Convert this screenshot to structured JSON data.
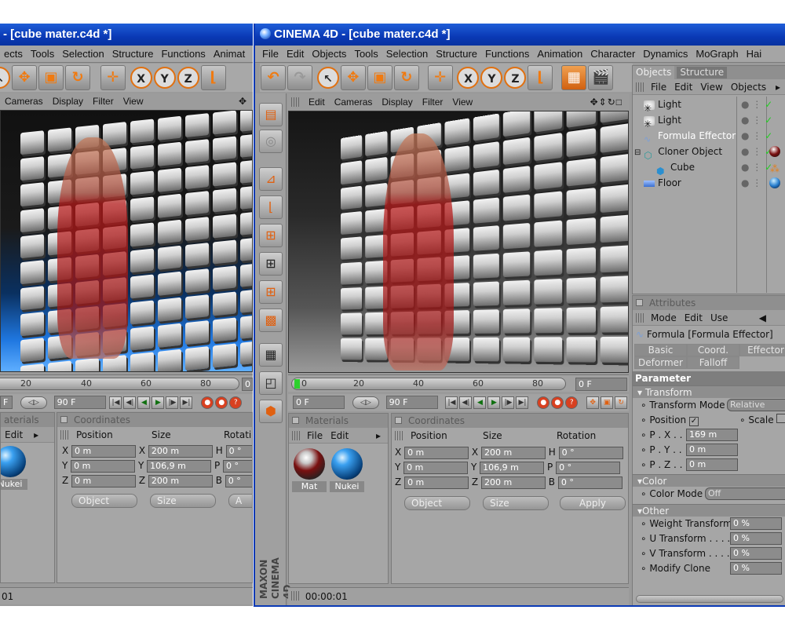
{
  "left_window": {
    "title": "- [cube mater.c4d *]",
    "menu": [
      "ects",
      "Tools",
      "Selection",
      "Structure",
      "Functions",
      "Animat"
    ],
    "viewport_menu": [
      "Cameras",
      "Display",
      "Filter",
      "View"
    ],
    "ruler_ticks": [
      "20",
      "40",
      "60",
      "80"
    ],
    "frame_start": "F",
    "frame_end": "90 F",
    "materials_header": "aterials",
    "materials_menu": [
      "Edit"
    ],
    "material_label": "Nukei",
    "coordinates_header": "Coordinates",
    "coord_cols": [
      "Position",
      "Size",
      "Rotatio"
    ],
    "pos": [
      "0 m",
      "0 m",
      "0 m"
    ],
    "size": [
      "200 m",
      "106,9 m",
      "200 m"
    ],
    "rot": [
      "0 °",
      "0 °",
      "0 °"
    ],
    "btn_object": "Object",
    "btn_size": "Size",
    "btn_apply": "A",
    "status_time": "01"
  },
  "window": {
    "title": "CINEMA 4D - [cube mater.c4d *]",
    "menu": [
      "File",
      "Edit",
      "Objects",
      "Tools",
      "Selection",
      "Structure",
      "Functions",
      "Animation",
      "Character",
      "Dynamics",
      "MoGraph",
      "Hai"
    ],
    "viewport_menu": [
      "Edit",
      "Cameras",
      "Display",
      "Filter",
      "View"
    ],
    "ruler_ticks": [
      "0",
      "20",
      "40",
      "60",
      "80"
    ],
    "current_frame": "0 F",
    "frame_start": "0 F",
    "frame_end": "90 F",
    "materials_header": "Materials",
    "materials_menu": [
      "File",
      "Edit"
    ],
    "materials": [
      {
        "label": "Mat"
      },
      {
        "label": "Nukei"
      }
    ],
    "coordinates_header": "Coordinates",
    "coord_cols": [
      "Position",
      "Size",
      "Rotation"
    ],
    "axes": [
      "X",
      "Y",
      "Z"
    ],
    "rot_axes": [
      "H",
      "P",
      "B"
    ],
    "pos": [
      "0 m",
      "0 m",
      "0 m"
    ],
    "size": [
      "200 m",
      "106,9 m",
      "200 m"
    ],
    "rot": [
      "0 °",
      "0 °",
      "0 °"
    ],
    "btn_object": "Object",
    "btn_size": "Size",
    "btn_apply": "Apply",
    "status_time": "00:00:01",
    "brand": "MAXON CINEMA 4D"
  },
  "objects_panel": {
    "tabs": [
      "Objects",
      "Structure"
    ],
    "menu": [
      "File",
      "Edit",
      "View",
      "Objects"
    ],
    "items": [
      {
        "label": "Light",
        "icon": "light-icon",
        "indent": 0
      },
      {
        "label": "Light",
        "icon": "light-icon",
        "indent": 0
      },
      {
        "label": "Formula Effector",
        "icon": "effector-icon",
        "indent": 0
      },
      {
        "label": "Cloner Object",
        "icon": "cloner-icon",
        "indent": 0
      },
      {
        "label": "Cube",
        "icon": "cube-icon",
        "indent": 1
      },
      {
        "label": "Floor",
        "icon": "floor-icon",
        "indent": 0
      }
    ]
  },
  "attributes_panel": {
    "header": "Attributes",
    "menu": [
      "Mode",
      "Edit",
      "Use"
    ],
    "object_title": "Formula [Formula Effector]",
    "tabs": [
      "Basic",
      "Coord.",
      "Effector",
      "Deformer",
      "Falloff"
    ],
    "parameter": "Parameter",
    "transform_section": "Transform",
    "transform_mode_label": "Transform Mode",
    "transform_mode_value": "Relative",
    "position_label": "Position",
    "scale_label": "Scale",
    "px_label": "P . X",
    "px_value": "169 m",
    "py_label": "P . Y",
    "py_value": "0 m",
    "pz_label": "P . Z",
    "pz_value": "0 m",
    "color_section": "Color",
    "color_mode_label": "Color Mode",
    "color_mode_value": "Off",
    "other_section": "Other",
    "weight_label": "Weight Transform",
    "weight_value": "0 %",
    "u_label": "U Transform",
    "u_value": "0 %",
    "v_label": "V Transform",
    "v_value": "0 %",
    "modify_label": "Modify Clone",
    "modify_value": "0 %"
  },
  "colors": {
    "titlebar": "#0a39b5",
    "accent": "#f07a10",
    "floor_blue": "#1f77e0"
  }
}
